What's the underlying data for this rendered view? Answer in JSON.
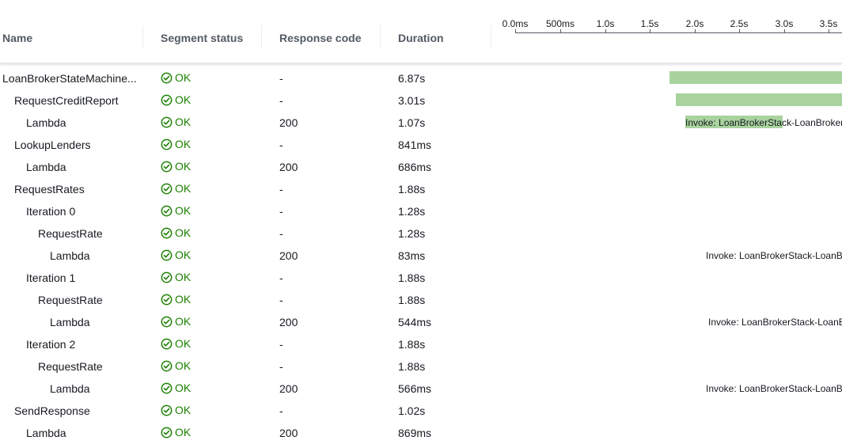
{
  "header": {
    "name": "Name",
    "segment_status": "Segment status",
    "response_code": "Response code",
    "duration": "Duration"
  },
  "timeline": {
    "ticks": [
      "0.0ms",
      "500ms",
      "1.0s",
      "1.5s",
      "2.0s",
      "2.5s",
      "3.0s",
      "3.5s"
    ]
  },
  "colors": {
    "ok_green": "#1d8102",
    "bar_green": "#a9d39e",
    "header_text": "#545b64"
  },
  "rows": [
    {
      "name": "LoanBrokerStateMachine...",
      "status": "OK",
      "response": "-",
      "duration": "6.87s",
      "bar_label": ""
    },
    {
      "name": "RequestCreditReport",
      "status": "OK",
      "response": "-",
      "duration": "3.01s",
      "bar_label": ""
    },
    {
      "name": "Lambda",
      "status": "OK",
      "response": "200",
      "duration": "1.07s",
      "bar_label": "Invoke: LoanBrokerStack-LoanBroker"
    },
    {
      "name": "LookupLenders",
      "status": "OK",
      "response": "-",
      "duration": "841ms",
      "bar_label": ""
    },
    {
      "name": "Lambda",
      "status": "OK",
      "response": "200",
      "duration": "686ms",
      "bar_label": ""
    },
    {
      "name": "RequestRates",
      "status": "OK",
      "response": "-",
      "duration": "1.88s",
      "bar_label": ""
    },
    {
      "name": "Iteration 0",
      "status": "OK",
      "response": "-",
      "duration": "1.28s",
      "bar_label": ""
    },
    {
      "name": "RequestRate",
      "status": "OK",
      "response": "-",
      "duration": "1.28s",
      "bar_label": ""
    },
    {
      "name": "Lambda",
      "status": "OK",
      "response": "200",
      "duration": "83ms",
      "bar_label": "Invoke: LoanBrokerStack-LoanB"
    },
    {
      "name": "Iteration 1",
      "status": "OK",
      "response": "-",
      "duration": "1.88s",
      "bar_label": ""
    },
    {
      "name": "RequestRate",
      "status": "OK",
      "response": "-",
      "duration": "1.88s",
      "bar_label": ""
    },
    {
      "name": "Lambda",
      "status": "OK",
      "response": "200",
      "duration": "544ms",
      "bar_label": "Invoke: LoanBrokerStack-LoanE"
    },
    {
      "name": "Iteration 2",
      "status": "OK",
      "response": "-",
      "duration": "1.88s",
      "bar_label": ""
    },
    {
      "name": "RequestRate",
      "status": "OK",
      "response": "-",
      "duration": "1.88s",
      "bar_label": ""
    },
    {
      "name": "Lambda",
      "status": "OK",
      "response": "200",
      "duration": "566ms",
      "bar_label": "Invoke: LoanBrokerStack-LoanB"
    },
    {
      "name": "SendResponse",
      "status": "OK",
      "response": "-",
      "duration": "1.02s",
      "bar_label": ""
    },
    {
      "name": "Lambda",
      "status": "OK",
      "response": "200",
      "duration": "869ms",
      "bar_label": ""
    }
  ]
}
